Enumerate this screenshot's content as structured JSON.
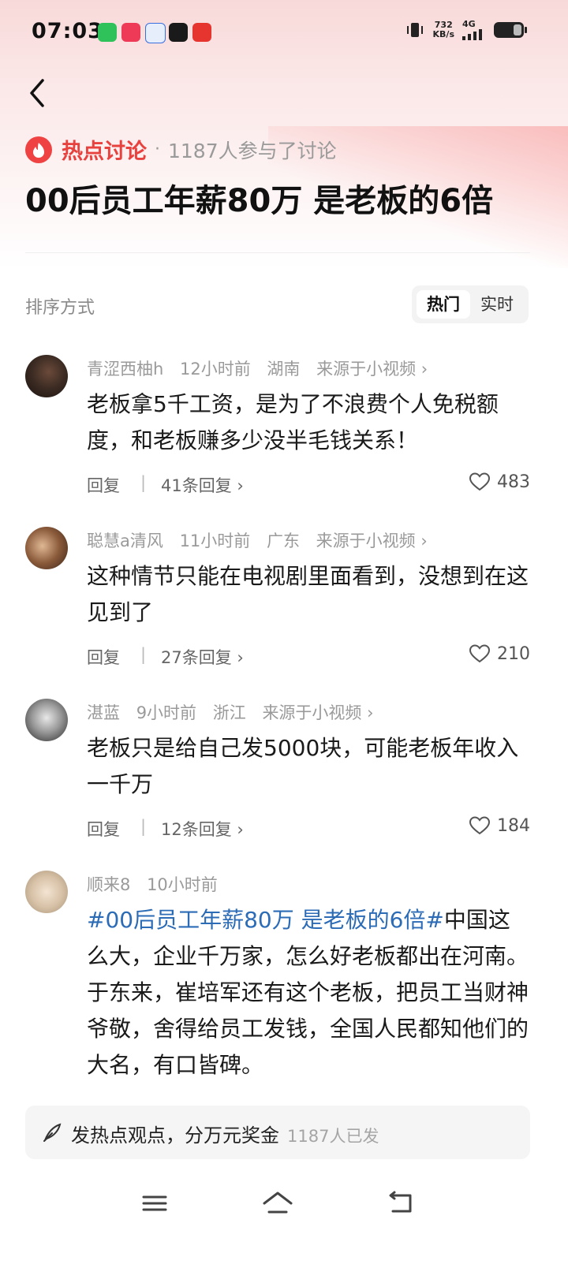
{
  "status_bar": {
    "time": "07:03",
    "speed_value": "732",
    "speed_unit": "KB/s",
    "network": "4G"
  },
  "topic": {
    "label": "热点讨论",
    "separator": "·",
    "participants": "1187人参与了讨论",
    "title": "00后员工年薪80万 是老板的6倍"
  },
  "sort": {
    "label": "排序方式",
    "options": [
      "热门",
      "实时"
    ],
    "selected": "热门"
  },
  "comments": [
    {
      "user": "青涩西柚h",
      "time": "12小时前",
      "location": "湖南",
      "source": "来源于小视频 ›",
      "text": "老板拿5千工资，是为了不浪费个人免税额度，和老板赚多少没半毛钱关系！",
      "reply_label": "回复",
      "reply_count": "41条回复 ›",
      "likes": "483"
    },
    {
      "user": "聪慧a清风",
      "time": "11小时前",
      "location": "广东",
      "source": "来源于小视频 ›",
      "text": "这种情节只能在电视剧里面看到，没想到在这见到了",
      "reply_label": "回复",
      "reply_count": "27条回复 ›",
      "likes": "210"
    },
    {
      "user": "湛蓝",
      "time": "9小时前",
      "location": "浙江",
      "source": "来源于小视频 ›",
      "text": "老板只是给自己发5000块，可能老板年收入一千万",
      "reply_label": "回复",
      "reply_count": "12条回复 ›",
      "likes": "184"
    },
    {
      "user": "顺来8",
      "time": "10小时前",
      "hashtag": "#00后员工年薪80万 是老板的6倍#",
      "text": "中国这么大，企业千万家，怎么好老板都出在河南。于东来，崔培军还有这个老板，把员工当财神爷敬，舍得给员工发钱，全国人民都知他们的大名，有口皆碑。"
    }
  ],
  "post_bar": {
    "text": "发热点观点，分万元奖金",
    "count": "1187人已发"
  },
  "colors": {
    "accent": "#e8423f",
    "hashtag": "#2c6bb5",
    "muted": "#9a9a9a"
  },
  "icons": [
    "back-icon",
    "fire-icon",
    "heart-icon",
    "pen-icon",
    "menu-icon",
    "home-icon",
    "return-icon"
  ]
}
